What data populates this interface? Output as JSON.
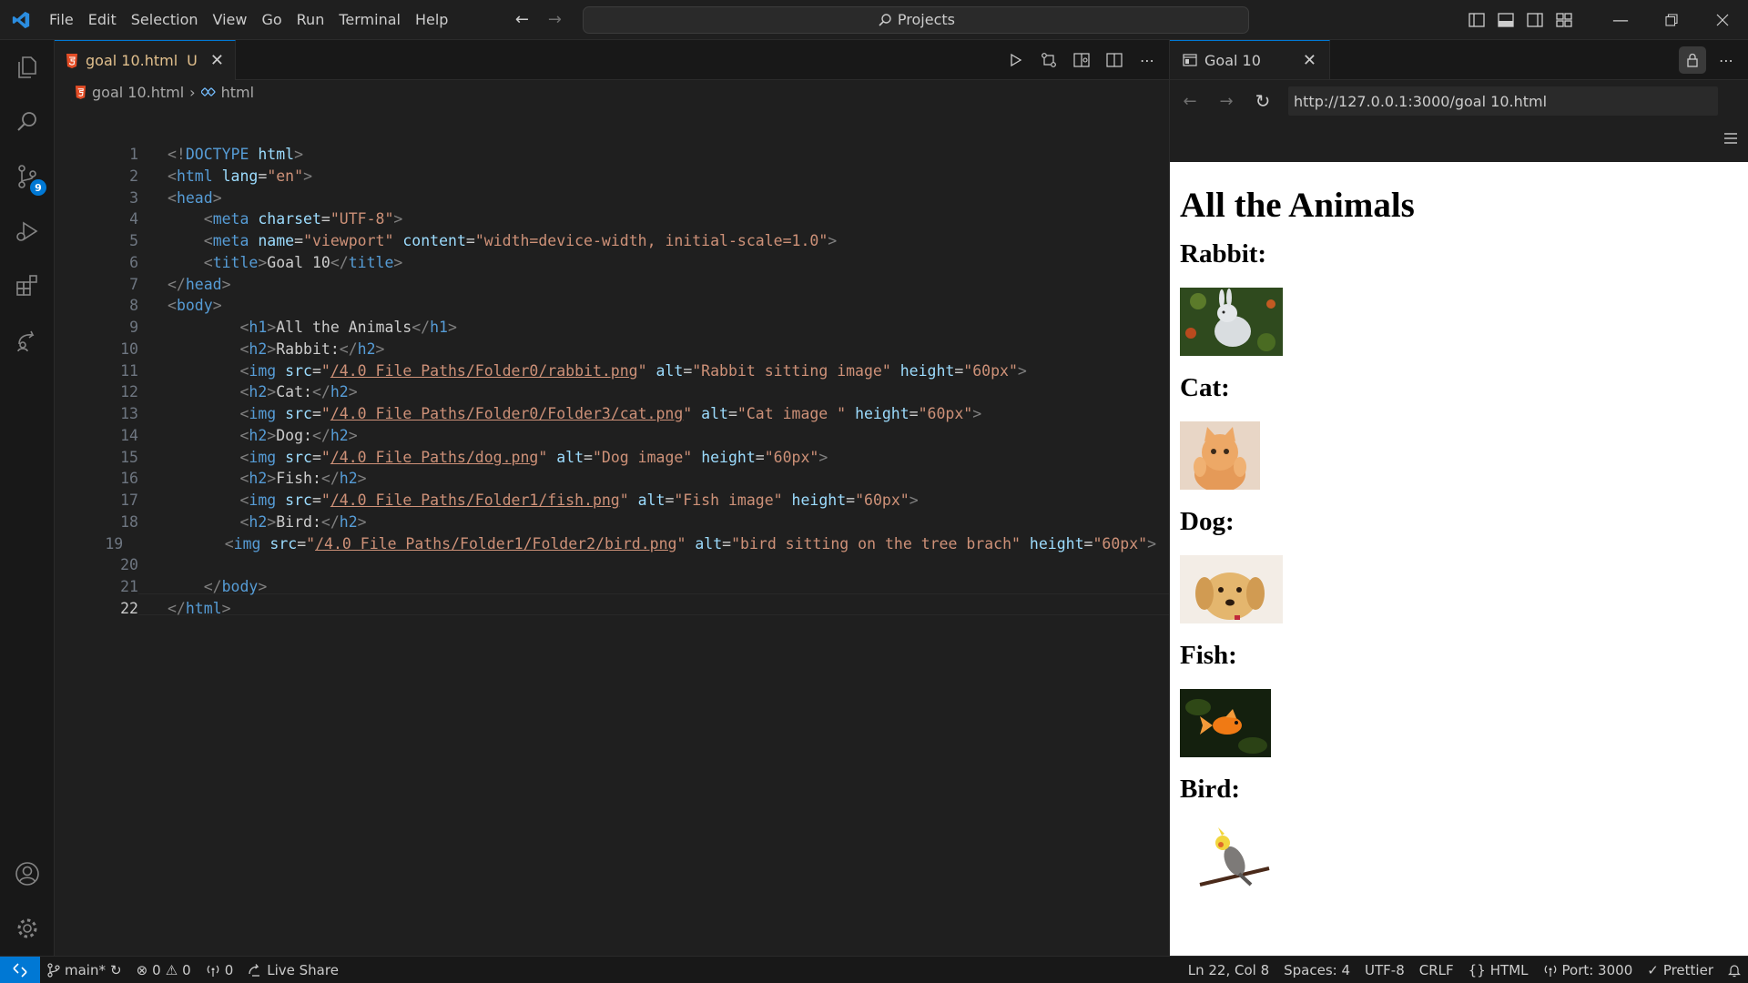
{
  "menu": [
    "File",
    "Edit",
    "Selection",
    "View",
    "Go",
    "Run",
    "Terminal",
    "Help"
  ],
  "command_center": {
    "label": "Projects"
  },
  "activity_bar": {
    "source_control_badge": "9"
  },
  "editor": {
    "tab": {
      "label": "goal 10.html",
      "modified": "U"
    },
    "breadcrumb": {
      "file": "goal 10.html",
      "symbol": "html"
    },
    "active_line": 22,
    "lines": [
      [
        [
          "tg",
          "<!"
        ],
        [
          "tn",
          "DOCTYPE"
        ],
        [
          "t",
          " "
        ],
        [
          "an",
          "html"
        ],
        [
          "tg",
          ">"
        ]
      ],
      [
        [
          "tg",
          "<"
        ],
        [
          "tn",
          "html"
        ],
        [
          "t",
          " "
        ],
        [
          "an",
          "lang"
        ],
        [
          "t",
          "="
        ],
        [
          "av",
          "\"en\""
        ],
        [
          "tg",
          ">"
        ]
      ],
      [
        [
          "tg",
          "<"
        ],
        [
          "tn",
          "head"
        ],
        [
          "tg",
          ">"
        ]
      ],
      [
        [
          "t",
          "    "
        ],
        [
          "tg",
          "<"
        ],
        [
          "tn",
          "meta"
        ],
        [
          "t",
          " "
        ],
        [
          "an",
          "charset"
        ],
        [
          "t",
          "="
        ],
        [
          "av",
          "\"UTF-8\""
        ],
        [
          "tg",
          ">"
        ]
      ],
      [
        [
          "t",
          "    "
        ],
        [
          "tg",
          "<"
        ],
        [
          "tn",
          "meta"
        ],
        [
          "t",
          " "
        ],
        [
          "an",
          "name"
        ],
        [
          "t",
          "="
        ],
        [
          "av",
          "\"viewport\""
        ],
        [
          "t",
          " "
        ],
        [
          "an",
          "content"
        ],
        [
          "t",
          "="
        ],
        [
          "av",
          "\"width=device-width, initial-scale=1.0\""
        ],
        [
          "tg",
          ">"
        ]
      ],
      [
        [
          "t",
          "    "
        ],
        [
          "tg",
          "<"
        ],
        [
          "tn",
          "title"
        ],
        [
          "tg",
          ">"
        ],
        [
          "t",
          "Goal 10"
        ],
        [
          "tg",
          "</"
        ],
        [
          "tn",
          "title"
        ],
        [
          "tg",
          ">"
        ]
      ],
      [
        [
          "tg",
          "</"
        ],
        [
          "tn",
          "head"
        ],
        [
          "tg",
          ">"
        ]
      ],
      [
        [
          "tg",
          "<"
        ],
        [
          "tn",
          "body"
        ],
        [
          "tg",
          ">"
        ]
      ],
      [
        [
          "t",
          "        "
        ],
        [
          "tg",
          "<"
        ],
        [
          "tn",
          "h1"
        ],
        [
          "tg",
          ">"
        ],
        [
          "t",
          "All the Animals"
        ],
        [
          "tg",
          "</"
        ],
        [
          "tn",
          "h1"
        ],
        [
          "tg",
          ">"
        ]
      ],
      [
        [
          "t",
          "        "
        ],
        [
          "tg",
          "<"
        ],
        [
          "tn",
          "h2"
        ],
        [
          "tg",
          ">"
        ],
        [
          "t",
          "Rabbit:"
        ],
        [
          "tg",
          "</"
        ],
        [
          "tn",
          "h2"
        ],
        [
          "tg",
          ">"
        ]
      ],
      [
        [
          "t",
          "        "
        ],
        [
          "tg",
          "<"
        ],
        [
          "tn",
          "img"
        ],
        [
          "t",
          " "
        ],
        [
          "an",
          "src"
        ],
        [
          "t",
          "="
        ],
        [
          "av",
          "\""
        ],
        [
          "avu",
          "/4.0 File Paths/Folder0/rabbit.png"
        ],
        [
          "av",
          "\""
        ],
        [
          "t",
          " "
        ],
        [
          "an",
          "alt"
        ],
        [
          "t",
          "="
        ],
        [
          "av",
          "\"Rabbit sitting image\""
        ],
        [
          "t",
          " "
        ],
        [
          "an",
          "height"
        ],
        [
          "t",
          "="
        ],
        [
          "av",
          "\"60px\""
        ],
        [
          "tg",
          ">"
        ]
      ],
      [
        [
          "t",
          "        "
        ],
        [
          "tg",
          "<"
        ],
        [
          "tn",
          "h2"
        ],
        [
          "tg",
          ">"
        ],
        [
          "t",
          "Cat:"
        ],
        [
          "tg",
          "</"
        ],
        [
          "tn",
          "h2"
        ],
        [
          "tg",
          ">"
        ]
      ],
      [
        [
          "t",
          "        "
        ],
        [
          "tg",
          "<"
        ],
        [
          "tn",
          "img"
        ],
        [
          "t",
          " "
        ],
        [
          "an",
          "src"
        ],
        [
          "t",
          "="
        ],
        [
          "av",
          "\""
        ],
        [
          "avu",
          "/4.0 File Paths/Folder0/Folder3/cat.png"
        ],
        [
          "av",
          "\""
        ],
        [
          "t",
          " "
        ],
        [
          "an",
          "alt"
        ],
        [
          "t",
          "="
        ],
        [
          "av",
          "\"Cat image \""
        ],
        [
          "t",
          " "
        ],
        [
          "an",
          "height"
        ],
        [
          "t",
          "="
        ],
        [
          "av",
          "\"60px\""
        ],
        [
          "tg",
          ">"
        ]
      ],
      [
        [
          "t",
          "        "
        ],
        [
          "tg",
          "<"
        ],
        [
          "tn",
          "h2"
        ],
        [
          "tg",
          ">"
        ],
        [
          "t",
          "Dog:"
        ],
        [
          "tg",
          "</"
        ],
        [
          "tn",
          "h2"
        ],
        [
          "tg",
          ">"
        ]
      ],
      [
        [
          "t",
          "        "
        ],
        [
          "tg",
          "<"
        ],
        [
          "tn",
          "img"
        ],
        [
          "t",
          " "
        ],
        [
          "an",
          "src"
        ],
        [
          "t",
          "="
        ],
        [
          "av",
          "\""
        ],
        [
          "avu",
          "/4.0 File Paths/dog.png"
        ],
        [
          "av",
          "\""
        ],
        [
          "t",
          " "
        ],
        [
          "an",
          "alt"
        ],
        [
          "t",
          "="
        ],
        [
          "av",
          "\"Dog image\""
        ],
        [
          "t",
          " "
        ],
        [
          "an",
          "height"
        ],
        [
          "t",
          "="
        ],
        [
          "av",
          "\"60px\""
        ],
        [
          "tg",
          ">"
        ]
      ],
      [
        [
          "t",
          "        "
        ],
        [
          "tg",
          "<"
        ],
        [
          "tn",
          "h2"
        ],
        [
          "tg",
          ">"
        ],
        [
          "t",
          "Fish:"
        ],
        [
          "tg",
          "</"
        ],
        [
          "tn",
          "h2"
        ],
        [
          "tg",
          ">"
        ]
      ],
      [
        [
          "t",
          "        "
        ],
        [
          "tg",
          "<"
        ],
        [
          "tn",
          "img"
        ],
        [
          "t",
          " "
        ],
        [
          "an",
          "src"
        ],
        [
          "t",
          "="
        ],
        [
          "av",
          "\""
        ],
        [
          "avu",
          "/4.0 File Paths/Folder1/fish.png"
        ],
        [
          "av",
          "\""
        ],
        [
          "t",
          " "
        ],
        [
          "an",
          "alt"
        ],
        [
          "t",
          "="
        ],
        [
          "av",
          "\"Fish image\""
        ],
        [
          "t",
          " "
        ],
        [
          "an",
          "height"
        ],
        [
          "t",
          "="
        ],
        [
          "av",
          "\"60px\""
        ],
        [
          "tg",
          ">"
        ]
      ],
      [
        [
          "t",
          "        "
        ],
        [
          "tg",
          "<"
        ],
        [
          "tn",
          "h2"
        ],
        [
          "tg",
          ">"
        ],
        [
          "t",
          "Bird:"
        ],
        [
          "tg",
          "</"
        ],
        [
          "tn",
          "h2"
        ],
        [
          "tg",
          ">"
        ]
      ],
      [
        [
          "t",
          "        "
        ],
        [
          "tg",
          "<"
        ],
        [
          "tn",
          "img"
        ],
        [
          "t",
          " "
        ],
        [
          "an",
          "src"
        ],
        [
          "t",
          "="
        ],
        [
          "av",
          "\""
        ],
        [
          "avu",
          "/4.0 File Paths/Folder1/Folder2/bird.png"
        ],
        [
          "av",
          "\""
        ],
        [
          "t",
          " "
        ],
        [
          "an",
          "alt"
        ],
        [
          "t",
          "="
        ],
        [
          "av",
          "\"bird sitting on the tree brach\""
        ],
        [
          "t",
          " "
        ],
        [
          "an",
          "height"
        ],
        [
          "t",
          "="
        ],
        [
          "av",
          "\"60px\""
        ],
        [
          "tg",
          ">"
        ]
      ],
      [
        [
          "t",
          ""
        ]
      ],
      [
        [
          "t",
          "    "
        ],
        [
          "tg",
          "</"
        ],
        [
          "tn",
          "body"
        ],
        [
          "tg",
          ">"
        ]
      ],
      [
        [
          "tg",
          "</"
        ],
        [
          "tn",
          "html"
        ],
        [
          "tg",
          ">"
        ]
      ]
    ]
  },
  "preview": {
    "tab_label": "Goal 10",
    "url": "http://127.0.0.1:3000/goal 10.html",
    "page": {
      "h1": "All the Animals",
      "animals": [
        {
          "heading": "Rabbit:",
          "image": "rabbit-photo"
        },
        {
          "heading": "Cat:",
          "image": "cat-photo"
        },
        {
          "heading": "Dog:",
          "image": "dog-photo"
        },
        {
          "heading": "Fish:",
          "image": "fish-photo"
        },
        {
          "heading": "Bird:",
          "image": "bird-photo"
        }
      ]
    }
  },
  "statusbar": {
    "branch": "main*",
    "errors": "0",
    "warnings": "0",
    "ports": "0",
    "live_share": "Live Share",
    "cursor": "Ln 22, Col 8",
    "spaces": "Spaces: 4",
    "encoding": "UTF-8",
    "eol": "CRLF",
    "language": "HTML",
    "port": "Port: 3000",
    "prettier": "Prettier"
  },
  "colors": {
    "accent": "#0078d4",
    "modified": "#e2c08d",
    "html_icon": "#e44d26"
  }
}
